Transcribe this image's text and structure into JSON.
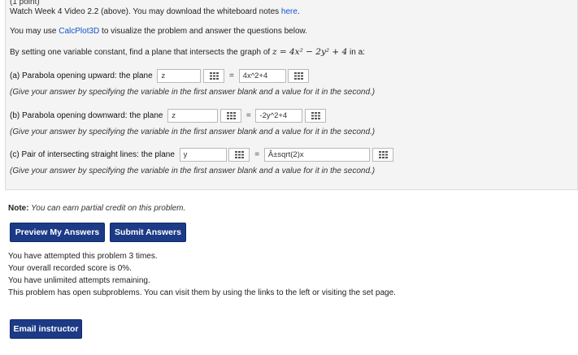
{
  "header": {
    "cutoff_text": "(1 point)",
    "watch_prefix": "Watch Week 4 Video 2.2 (above). You may download the whiteboard notes ",
    "watch_link": "here",
    "watch_suffix": ".",
    "calc_prefix": "You may use ",
    "calc_link": "CalcPlot3D",
    "calc_suffix": " to visualize the problem and answer the questions below.",
    "intro_prefix": "By setting one variable constant, find a plane that intersects the graph of ",
    "intro_math": "z = 4x² − 2y² + 4",
    "intro_suffix": " in a:"
  },
  "parts": [
    {
      "label": "(a) Parabola opening upward: the plane",
      "variable": "z",
      "equals": "=",
      "value": "4x^2+4",
      "hint": "(Give your answer by specifying the variable in the first answer blank and a value for it in the second.)"
    },
    {
      "label": "(b) Parabola opening downward: the plane",
      "variable": "z",
      "equals": "=",
      "value": "-2y^2+4",
      "hint": "(Give your answer by specifying the variable in the first answer blank and a value for it in the second.)"
    },
    {
      "label": "(c) Pair of intersecting straight lines: the plane",
      "variable": "y",
      "equals": "=",
      "value": "Â±sqrt(2)x",
      "hint": "(Give your answer by specifying the variable in the first answer blank and a value for it in the second.)"
    }
  ],
  "note": {
    "label": "Note:",
    "text": " You can earn partial credit on this problem."
  },
  "buttons": {
    "preview": "Preview My Answers",
    "submit": "Submit Answers",
    "email": "Email instructor"
  },
  "status": {
    "attempts": "You have attempted this problem 3 times.",
    "score": "Your overall recorded score is 0%.",
    "remaining": "You have unlimited attempts remaining.",
    "subproblems": "This problem has open subproblems. You can visit them by using the links to the left or visiting the set page."
  }
}
